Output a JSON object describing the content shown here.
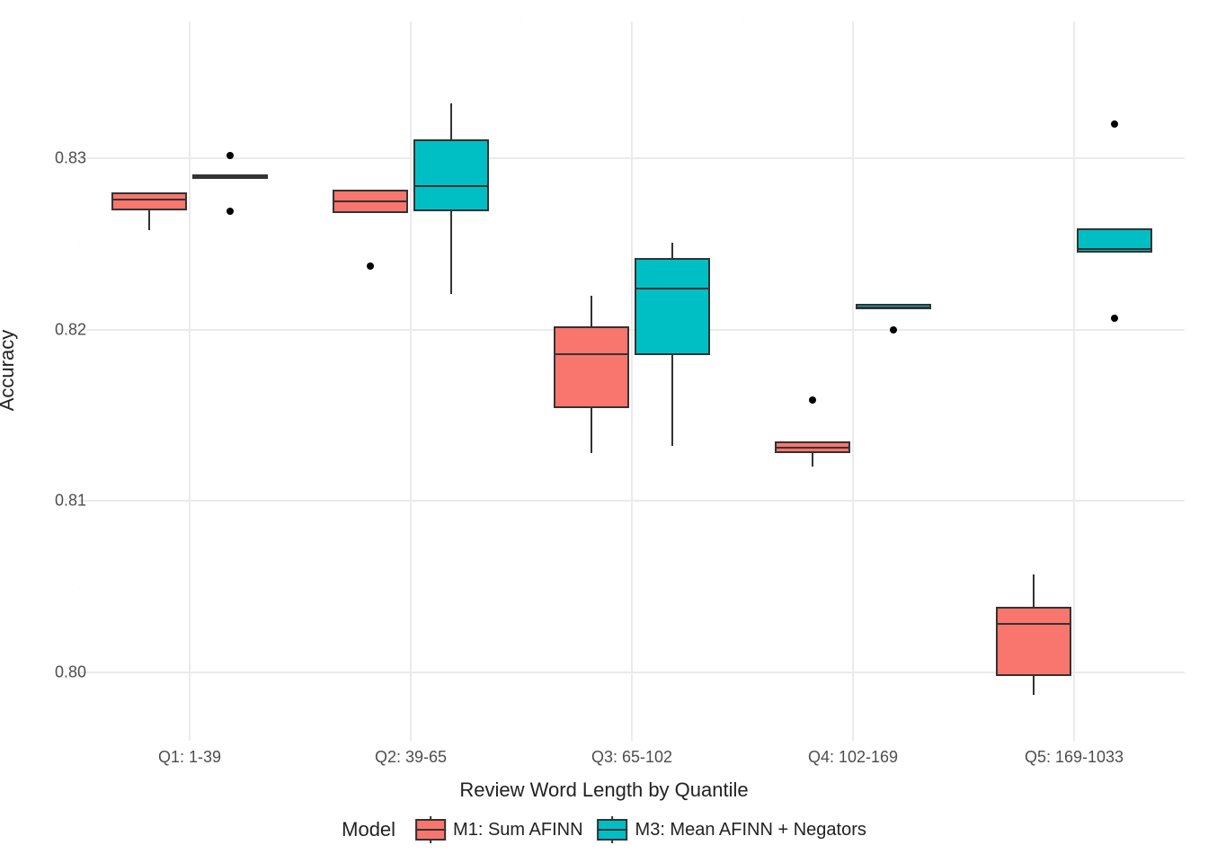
{
  "axes": {
    "ylabel": "Accuracy",
    "xlabel": "Review Word Length by Quantile",
    "y_ticks": [
      0.8,
      0.81,
      0.82,
      0.83
    ],
    "x_ticks": [
      "Q1: 1-39",
      "Q2: 39-65",
      "Q3: 65-102",
      "Q4: 102-169",
      "Q5: 169-1033"
    ]
  },
  "legend": {
    "title": "Model",
    "items": [
      "M1: Sum AFINN",
      "M3: Mean AFINN + Negators"
    ]
  },
  "colors": {
    "m1": "#f8766d",
    "m3": "#00bfc4"
  },
  "chart_data": {
    "type": "boxplot",
    "xlabel": "Review Word Length by Quantile",
    "ylabel": "Accuracy",
    "ylim": [
      0.796,
      0.838
    ],
    "categories": [
      "Q1: 1-39",
      "Q2: 39-65",
      "Q3: 65-102",
      "Q4: 102-169",
      "Q5: 169-1033"
    ],
    "series": [
      {
        "name": "M1: Sum AFINN",
        "color": "#f8766d",
        "boxes": [
          {
            "q1": 0.827,
            "median": 0.8276,
            "q3": 0.828,
            "ymin": 0.8258,
            "ymax": 0.828,
            "outliers": []
          },
          {
            "q1": 0.8268,
            "median": 0.8275,
            "q3": 0.8282,
            "ymin": 0.8268,
            "ymax": 0.8282,
            "outliers": [
              0.8237
            ]
          },
          {
            "q1": 0.8154,
            "median": 0.8186,
            "q3": 0.8202,
            "ymin": 0.8128,
            "ymax": 0.822,
            "outliers": []
          },
          {
            "q1": 0.8128,
            "median": 0.8131,
            "q3": 0.8135,
            "ymin": 0.812,
            "ymax": 0.8135,
            "outliers": [
              0.8159
            ]
          },
          {
            "q1": 0.7998,
            "median": 0.8028,
            "q3": 0.8038,
            "ymin": 0.7987,
            "ymax": 0.8057,
            "outliers": []
          }
        ]
      },
      {
        "name": "M3: Mean AFINN + Negators",
        "color": "#00bfc4",
        "boxes": [
          {
            "q1": 0.8289,
            "median": 0.829,
            "q3": 0.829,
            "ymin": 0.8289,
            "ymax": 0.829,
            "outliers": [
              0.8302,
              0.8269
            ]
          },
          {
            "q1": 0.8269,
            "median": 0.8284,
            "q3": 0.8311,
            "ymin": 0.8221,
            "ymax": 0.8332,
            "outliers": []
          },
          {
            "q1": 0.8185,
            "median": 0.8224,
            "q3": 0.8242,
            "ymin": 0.8132,
            "ymax": 0.8251,
            "outliers": []
          },
          {
            "q1": 0.8212,
            "median": 0.8213,
            "q3": 0.8215,
            "ymin": 0.8212,
            "ymax": 0.8215,
            "outliers": [
              0.82
            ]
          },
          {
            "q1": 0.8245,
            "median": 0.8247,
            "q3": 0.8259,
            "ymin": 0.8245,
            "ymax": 0.8259,
            "outliers": [
              0.832,
              0.8207
            ]
          }
        ]
      }
    ]
  }
}
